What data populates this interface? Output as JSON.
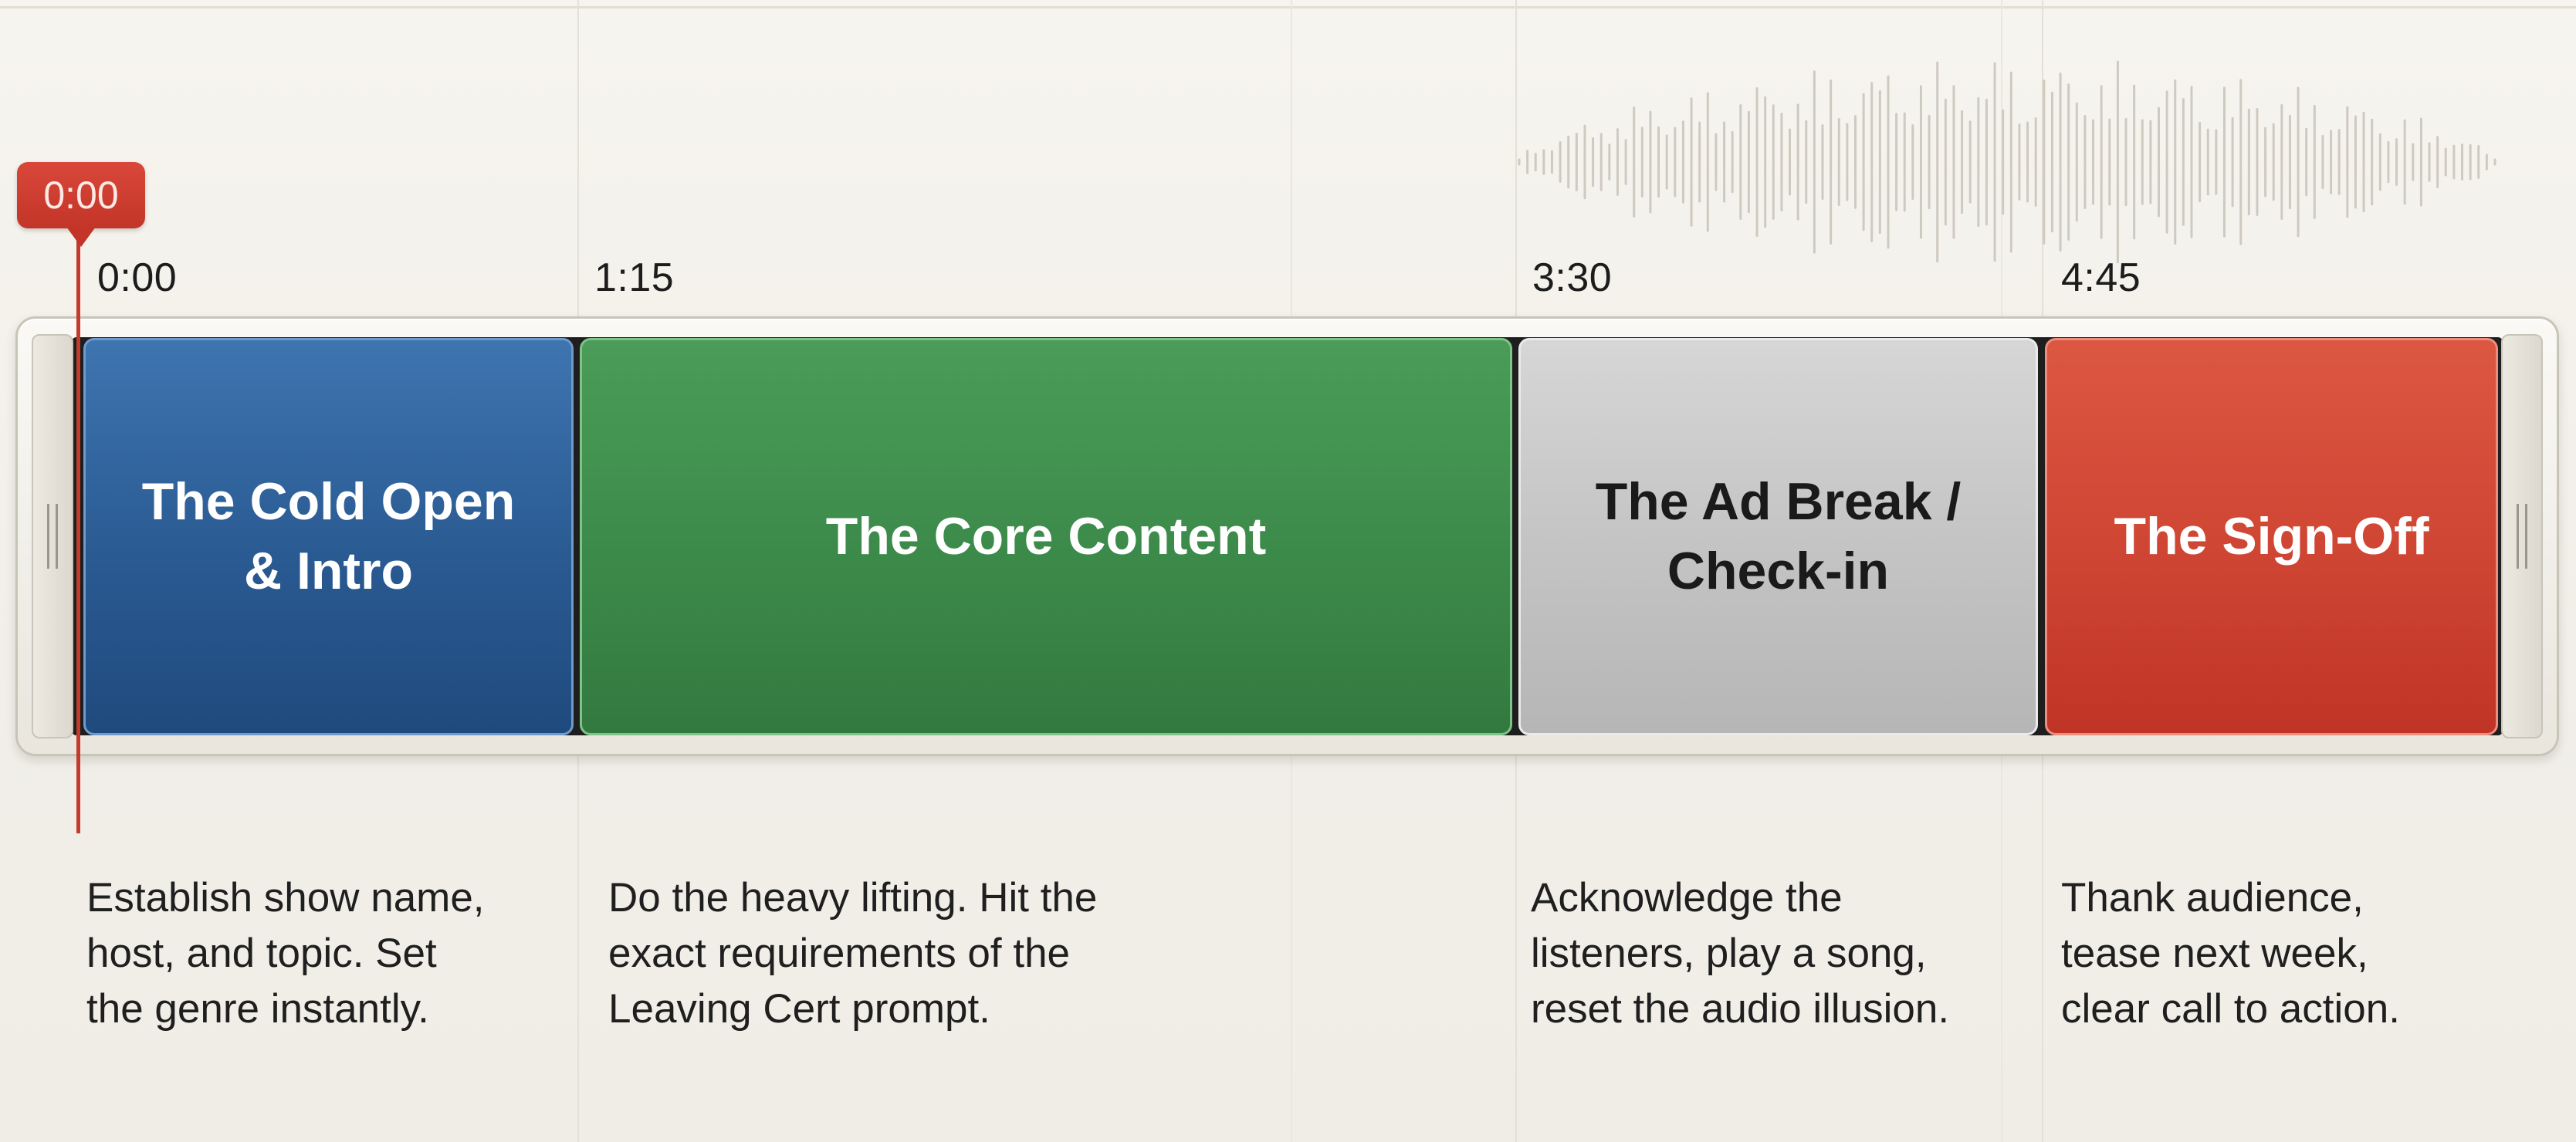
{
  "playhead": {
    "time": "0:00"
  },
  "markers": [
    {
      "time": "0:00"
    },
    {
      "time": "1:15"
    },
    {
      "time": "3:30"
    },
    {
      "time": "4:45"
    }
  ],
  "segments": [
    {
      "title_lines": [
        "The Cold Open",
        "& Intro"
      ],
      "color": "#2a5a92",
      "description_lines": [
        "Establish show name,",
        "host, and topic. Set",
        "the genre instantly."
      ]
    },
    {
      "title_lines": [
        "The Core Content"
      ],
      "color": "#3c8a4a",
      "description_lines": [
        "Do the heavy lifting. Hit the",
        "exact requirements of the",
        "Leaving Cert prompt."
      ]
    },
    {
      "title_lines": [
        "The Ad Break /",
        "Check-in"
      ],
      "color": "#c3c3c3",
      "description_lines": [
        "Acknowledge the",
        "listeners, play a song,",
        "reset the audio illusion."
      ]
    },
    {
      "title_lines": [
        "The Sign-Off"
      ],
      "color": "#cf4533",
      "description_lines": [
        "Thank audience,",
        "tease next week,",
        "clear call to action."
      ]
    }
  ],
  "icons": {
    "left_handle": "grip-lines-icon",
    "right_handle": "grip-lines-icon",
    "playhead": "playhead-marker-icon",
    "background": "audio-waveform-icon"
  }
}
